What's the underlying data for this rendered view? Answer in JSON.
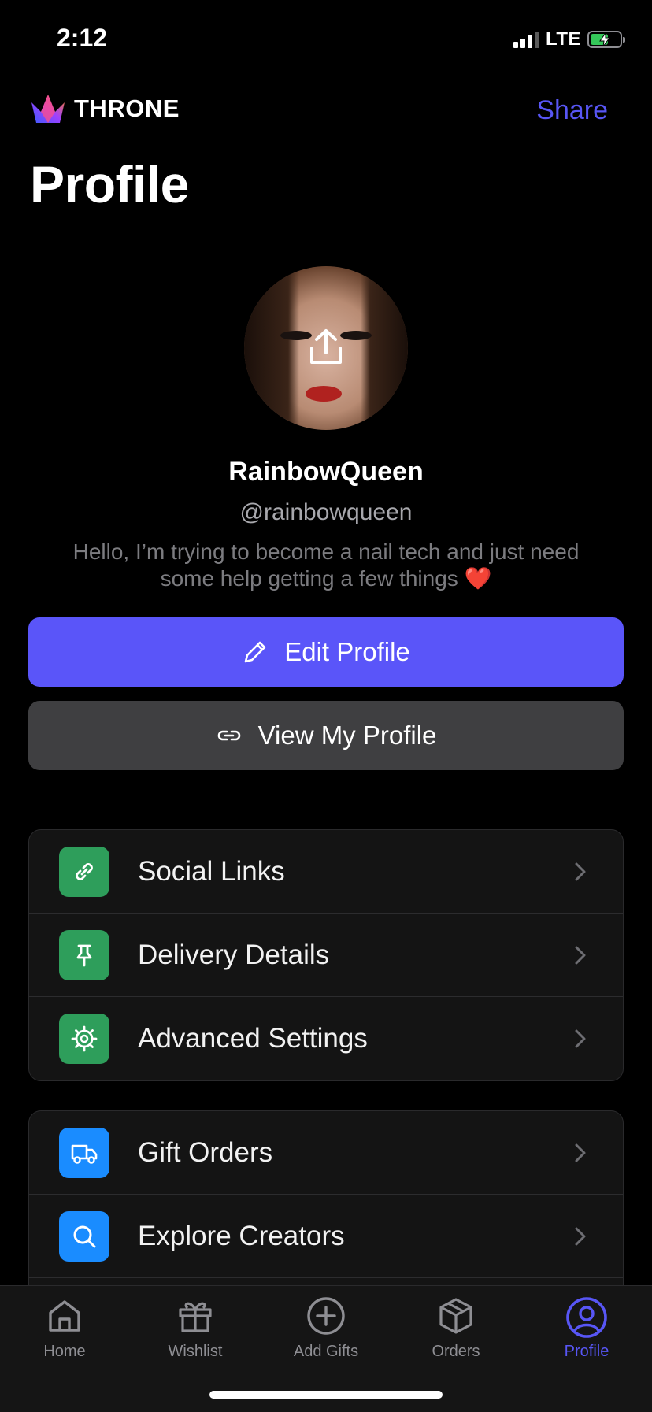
{
  "status_bar": {
    "time": "2:12",
    "network": "LTE",
    "battery_level": 0.6,
    "battery_color": "#34c759"
  },
  "header": {
    "brand": "THRONE",
    "share_label": "Share",
    "title": "Profile"
  },
  "profile": {
    "display_name": "RainbowQueen",
    "handle": "@rainbowqueen",
    "bio": "Hello, I’m trying to become a nail tech and just need some help getting a few things ❤️"
  },
  "buttons": {
    "edit_profile": "Edit Profile",
    "view_profile": "View My Profile"
  },
  "settings_group": {
    "items": [
      {
        "label": "Social Links",
        "icon": "link-icon",
        "color": "#2e9e5b"
      },
      {
        "label": "Delivery Details",
        "icon": "pin-icon",
        "color": "#2e9e5b"
      },
      {
        "label": "Advanced Settings",
        "icon": "gear-icon",
        "color": "#2e9e5b"
      }
    ]
  },
  "activity_group": {
    "items": [
      {
        "label": "Gift Orders",
        "icon": "truck-icon",
        "color": "#1a8cff"
      },
      {
        "label": "Explore Creators",
        "icon": "search-icon",
        "color": "#1a8cff"
      }
    ]
  },
  "tabs": [
    {
      "label": "Home",
      "icon": "home-icon"
    },
    {
      "label": "Wishlist",
      "icon": "gift-icon"
    },
    {
      "label": "Add Gifts",
      "icon": "plus-circle-icon"
    },
    {
      "label": "Orders",
      "icon": "box-icon"
    },
    {
      "label": "Profile",
      "icon": "user-circle-icon",
      "active": true
    }
  ],
  "colors": {
    "accent": "#5a55f9",
    "tab_active": "#5856f5",
    "tab_inactive": "#8e8e93"
  }
}
